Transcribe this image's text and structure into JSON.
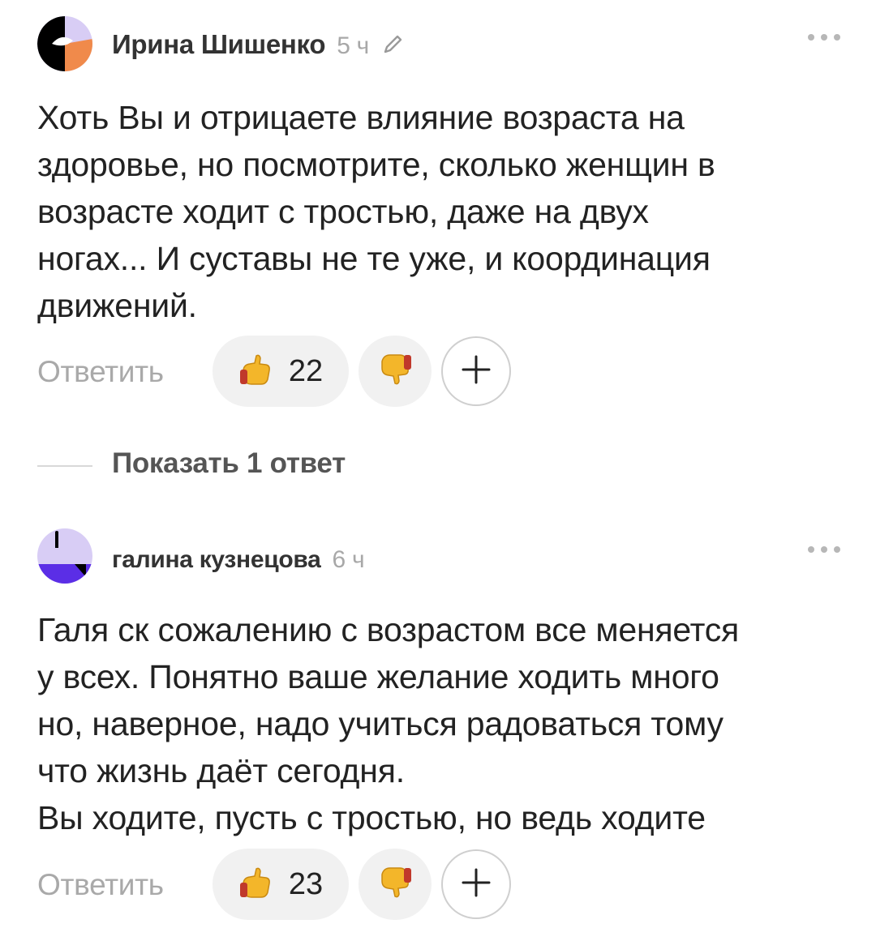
{
  "comments": [
    {
      "author": "Ирина Шишенко",
      "time": "5 ч",
      "edited": true,
      "text": "Хоть Вы и отрицаете влияние возраста на\nздоровье, но посмотрите, сколько женщин в\nвозрасте ходит с тростью, даже на двух\nногах... И суставы не те уже, и координация\nдвижений.",
      "reply_label": "Ответить",
      "likes": "22",
      "avatar_colors": [
        "#000000",
        "#d8cdf5",
        "#f08a4b"
      ]
    },
    {
      "author": "галина кузнецова",
      "time": "6 ч",
      "edited": false,
      "text": "Галя ск сожалению с возрастом все меняется\nу всех. Понятно ваше желание ходить много\nно, наверное, надо учиться радоваться тому\nчто жизнь даёт сегодня.\nВы ходите, пусть с тростью, но ведь ходите",
      "reply_label": "Ответить",
      "likes": "23",
      "avatar_colors": [
        "#d8cdf5",
        "#5b2ee6",
        "#000000"
      ]
    }
  ],
  "show_replies_label": "Показать 1 ответ",
  "icons": {
    "like": "thumbs-up-icon",
    "dislike": "thumbs-down-icon",
    "add": "plus-icon",
    "more": "more-dots-icon",
    "edit": "pencil-icon"
  }
}
